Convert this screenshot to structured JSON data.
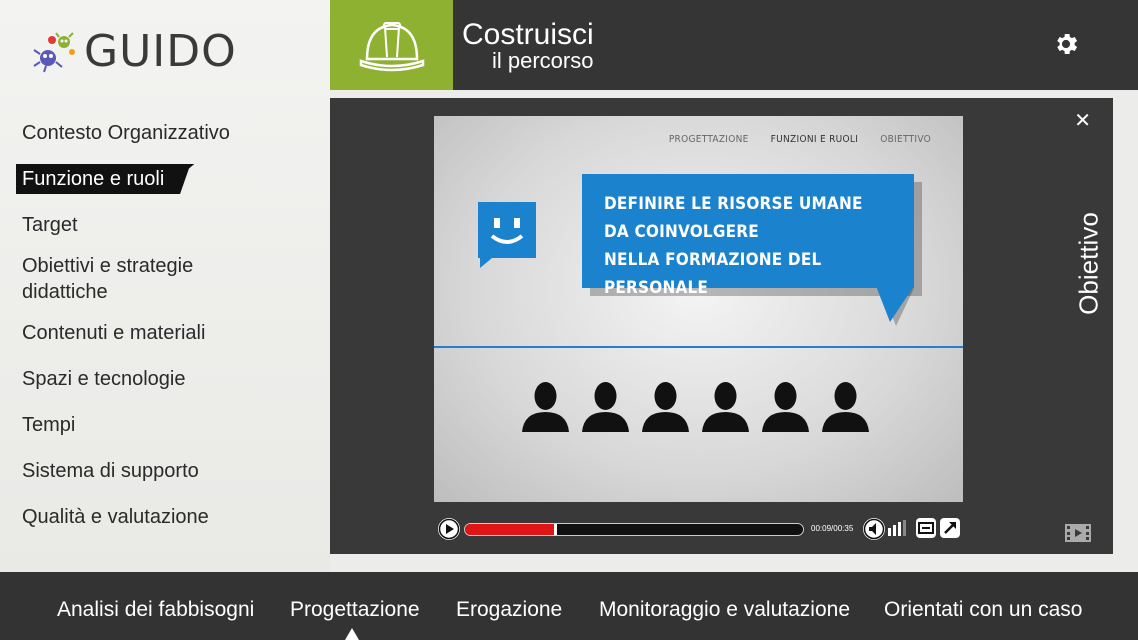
{
  "app": {
    "logo_text": "GUIDO"
  },
  "header": {
    "title_line1": "Costruisci",
    "title_line2": "il percorso",
    "accent_color": "#8fb132"
  },
  "sidebar": {
    "items": [
      {
        "label": "Contesto Organizzativo",
        "active": false
      },
      {
        "label": "Funzione e ruoli",
        "active": true
      },
      {
        "label": "Target",
        "active": false
      },
      {
        "label": "Obiettivi e strategie didattiche",
        "active": false
      },
      {
        "label": "Contenuti e materiali",
        "active": false
      },
      {
        "label": "Spazi e tecnologie",
        "active": false
      },
      {
        "label": "Tempi",
        "active": false
      },
      {
        "label": "Sistema di supporto",
        "active": false
      },
      {
        "label": "Qualità e valutazione",
        "active": false
      }
    ]
  },
  "panel": {
    "side_label": "Obiettivo",
    "close_icon": "close-icon",
    "film_icon": "film-icon"
  },
  "video": {
    "tabs": [
      "PROGETTAZIONE",
      "FUNZIONI E RUOLI",
      "OBIETTIVO"
    ],
    "bubble_lines": [
      "DEFINIRE LE RISORSE UMANE",
      "DA COINVOLGERE",
      "NELLA FORMAZIONE DEL PERSONALE"
    ],
    "people_count": 6,
    "bubble_color": "#1b82cd"
  },
  "player": {
    "time": "00:09/00:35",
    "progress": 0.27,
    "progress_color": "#e01616"
  },
  "bottom_nav": {
    "items": [
      {
        "label": "Analisi dei fabbisogni",
        "active": false
      },
      {
        "label": "Progettazione",
        "active": true
      },
      {
        "label": "Erogazione",
        "active": false
      },
      {
        "label": "Monitoraggio e valutazione",
        "active": false
      },
      {
        "label": "Orientati con un caso",
        "active": false
      }
    ]
  }
}
